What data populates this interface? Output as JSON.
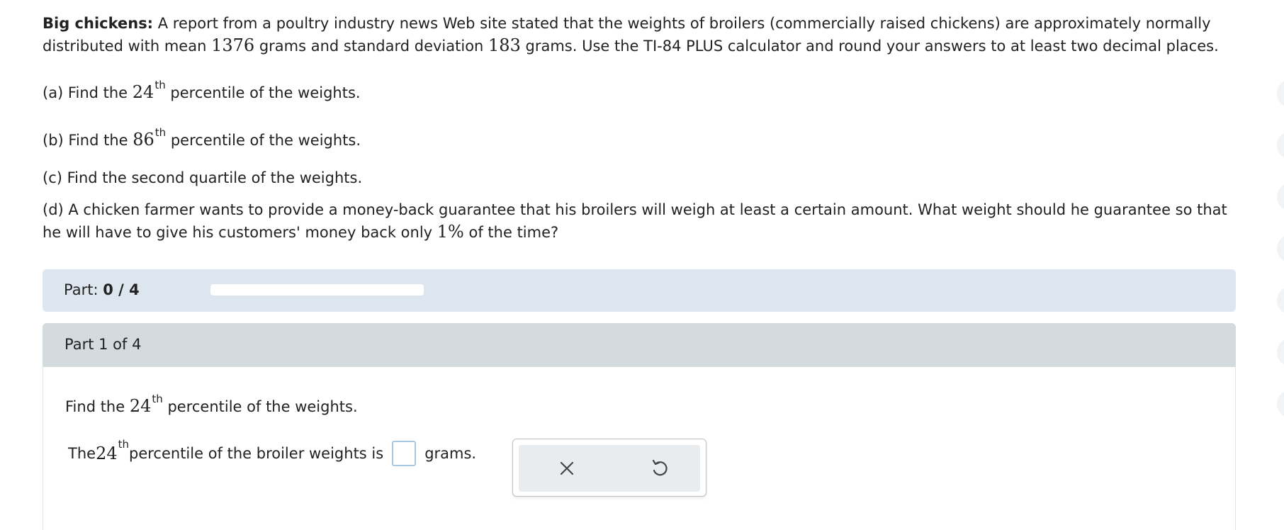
{
  "problem": {
    "title": "Big chickens:",
    "intro_1": " A report from a poultry industry news Web site stated that the weights of broilers (commercially raised chickens) are approximately normally distributed with mean ",
    "mean": "1376",
    "intro_2": " grams and standard deviation ",
    "sd": "183",
    "intro_3": " grams. Use the TI-84 PLUS calculator and round your answers to at least two decimal places.",
    "a": {
      "prefix": "(a) Find the ",
      "num": "24",
      "sup": "th",
      "suffix": " percentile of the weights."
    },
    "b": {
      "prefix": "(b) Find the ",
      "num": "86",
      "sup": "th",
      "suffix": " percentile of the weights."
    },
    "c": "(c) Find the second quartile of the weights.",
    "d": {
      "prefix": "(d) A chicken farmer wants to provide a money-back guarantee that his broilers will weigh at least a certain amount. What weight should he guarantee so that he will have to give his customers' money back only ",
      "pct": "1%",
      "suffix": " of the time?"
    }
  },
  "progress": {
    "label": "Part: ",
    "value": "0 / 4",
    "fraction": 0
  },
  "part": {
    "header": "Part 1 of 4",
    "prompt": {
      "prefix": "Find the ",
      "num": "24",
      "sup": "th",
      "suffix": " percentile of the weights."
    },
    "answer": {
      "prefix": "The ",
      "num": "24",
      "sup": "th",
      "middle": " percentile of the broiler weights is",
      "value": "",
      "unit": "grams."
    }
  },
  "tools": {
    "clear_icon": "close-icon",
    "undo_icon": "undo-icon"
  },
  "colors": {
    "progress_bg": "#dde6ef",
    "part_header_bg": "#d3dbdf",
    "input_border": "#a8c7e0",
    "tool_bg": "#e9ecee"
  }
}
